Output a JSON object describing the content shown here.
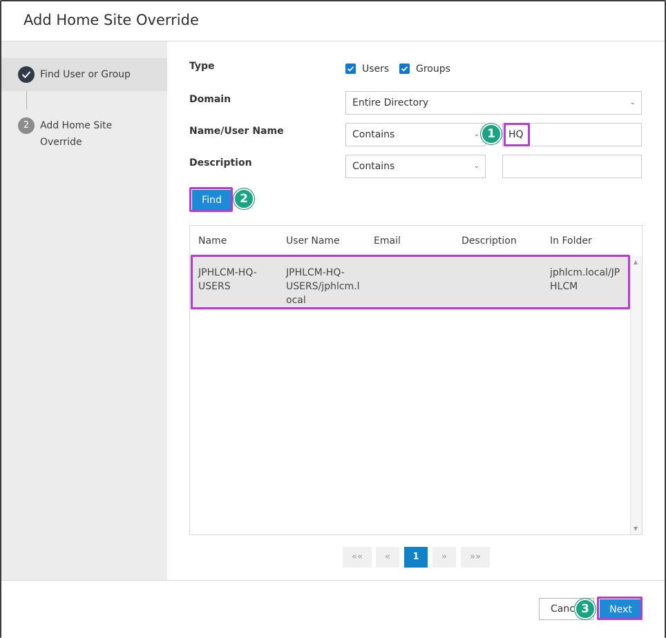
{
  "dialog": {
    "title": "Add Home Site Override"
  },
  "steps": [
    {
      "number": "",
      "label": "Find User or Group",
      "state": "completed"
    },
    {
      "number": "2",
      "label": "Add Home Site Override",
      "state": "pending"
    }
  ],
  "form": {
    "type_label": "Type",
    "users_label": "Users",
    "groups_label": "Groups",
    "domain_label": "Domain",
    "domain_value": "Entire Directory",
    "name_label": "Name/User Name",
    "name_operator": "Contains",
    "name_value": "HQ",
    "description_label": "Description",
    "description_operator": "Contains",
    "description_value": "",
    "find_label": "Find"
  },
  "table": {
    "columns": [
      "Name",
      "User Name",
      "Email",
      "Description",
      "In Folder"
    ],
    "rows": [
      {
        "name": [
          "JPHLCM-HQ-",
          "USERS"
        ],
        "user_name": [
          "JPHLCM-HQ-",
          "USERS/jphlcm.l",
          "ocal"
        ],
        "email": "",
        "description": "",
        "folder": [
          "jphlcm.local/JP",
          "HLCM"
        ]
      }
    ]
  },
  "pager": {
    "first": "««",
    "prev": "«",
    "current": "1",
    "next": "»",
    "last": "»»"
  },
  "footer": {
    "cancel_label": "Cancel",
    "next_label": "Next"
  },
  "callouts": [
    "1",
    "2",
    "3"
  ],
  "colors": {
    "accent": "#1d8ad5",
    "highlight": "#b93ad0",
    "badge": "#19a482"
  },
  "icons": {
    "step_done": "check-icon",
    "checkbox": "checkmark",
    "dropdown": "chevron-down-icon"
  }
}
